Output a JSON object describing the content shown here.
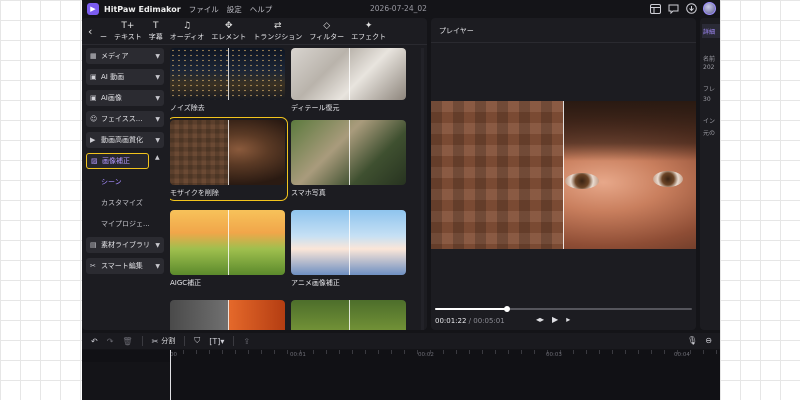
{
  "titlebar": {
    "app_name": "HitPaw Edimakor",
    "menu": [
      "ファイル",
      "設定",
      "ヘルプ"
    ],
    "project_title": "2026-07-24_02"
  },
  "toolbar": {
    "back_label": "ー",
    "tools": [
      {
        "icon": "T+",
        "label": "テキスト"
      },
      {
        "icon": "T",
        "label": "字幕"
      },
      {
        "icon": "♫",
        "label": "オーディオ"
      },
      {
        "icon": "✥",
        "label": "エレメント"
      },
      {
        "icon": "⇄",
        "label": "トランジション"
      },
      {
        "icon": "◇",
        "label": "フィルター"
      },
      {
        "icon": "✦",
        "label": "エフェクト"
      }
    ]
  },
  "sidebar": {
    "categories": [
      {
        "icon": "▦",
        "label": "メディア"
      },
      {
        "icon": "▣",
        "label": "AI 動画"
      },
      {
        "icon": "▣",
        "label": "AI画像"
      },
      {
        "icon": "☺",
        "label": "フェイスス..."
      },
      {
        "icon": "▶",
        "label": "動画高画質化"
      },
      {
        "icon": "▨",
        "label": "画像補正"
      }
    ],
    "subitems": [
      "シーン",
      "カスタマイズ",
      "マイプロジェ..."
    ],
    "more": [
      {
        "icon": "▤",
        "label": "素材ライブラリ"
      },
      {
        "icon": "✂",
        "label": "スマート編集"
      }
    ]
  },
  "templates": [
    {
      "label": "ノイズ除去"
    },
    {
      "label": "ディテール復元"
    },
    {
      "label": "モザイクを削除"
    },
    {
      "label": "スマホ写真"
    },
    {
      "label": "AIGC補正"
    },
    {
      "label": "アニメ画像補正"
    },
    {
      "label": ""
    },
    {
      "label": ""
    }
  ],
  "player": {
    "title": "プレイヤー",
    "current_time": "00:01:22",
    "total_time": " / 00:05:01",
    "progress": 0.28
  },
  "right_panel": {
    "tab": "詳細",
    "lines": [
      "名前",
      "202",
      "フレ",
      "30",
      "イン",
      "元の"
    ]
  },
  "editbar": {
    "split_label": "分割"
  },
  "ruler": {
    "ticks": [
      "00",
      "00:01",
      "00:02",
      "00:03",
      "00:04"
    ]
  },
  "colors": {
    "accent": "#a58cff",
    "highlight": "#f2c41d",
    "background": "#141418",
    "panel": "#1c1c21"
  }
}
